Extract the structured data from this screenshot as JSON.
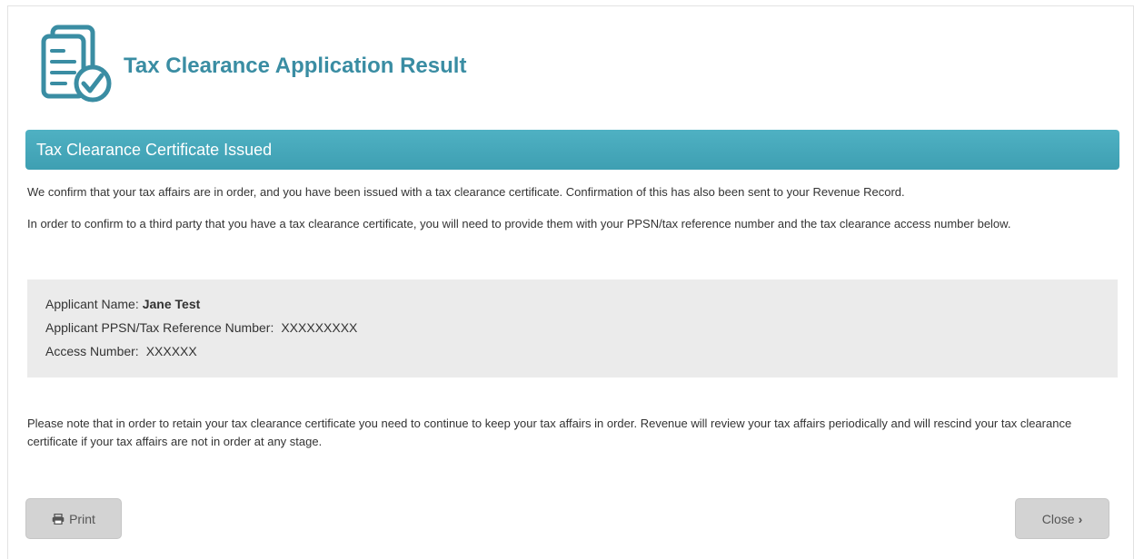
{
  "header": {
    "title": "Tax Clearance Application Result",
    "logo_icon": "document-checkmark-icon",
    "accent_color": "#3a8da3"
  },
  "banner": {
    "text": "Tax Clearance Certificate Issued",
    "color": "#45a7ba"
  },
  "paragraphs": {
    "confirmation": "We confirm that your tax affairs are in order, and you have been issued with a tax clearance certificate. Confirmation of this has also been sent to your Revenue Record.",
    "third_party": "In order to confirm to a third party that you have a tax clearance certificate, you will need to provide them with your PPSN/tax reference number and the tax clearance access number below.",
    "note": "Please note that in order to retain your tax clearance certificate you need to continue to keep your tax affairs in order. Revenue will review your tax affairs periodically and will rescind your tax clearance certificate if your tax affairs are not in order at any stage."
  },
  "details": {
    "applicant_name_label": "Applicant Name:",
    "applicant_name_value": "Jane Test",
    "ppsn_label": "Applicant PPSN/Tax Reference Number:",
    "ppsn_value": "XXXXXXXXX",
    "access_label": "Access Number:",
    "access_value": "XXXXXX"
  },
  "buttons": {
    "print_label": "Print",
    "print_icon": "printer-icon",
    "close_label": "Close",
    "close_icon": "chevron-right-icon"
  }
}
